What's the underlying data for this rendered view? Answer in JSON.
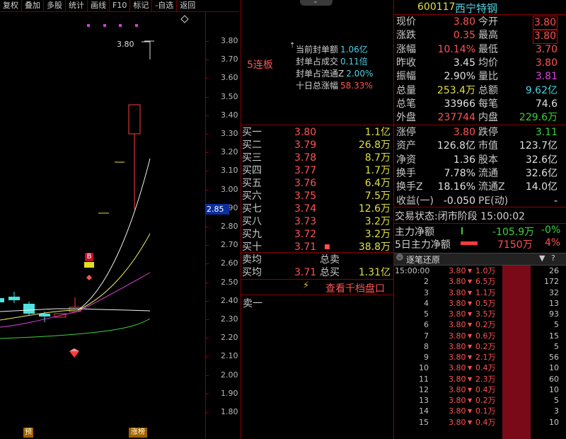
{
  "toolbar": {
    "items": [
      "复权",
      "叠加",
      "多股",
      "统计",
      "画线",
      "F10",
      "标记",
      "-自选",
      "返回"
    ]
  },
  "chart": {
    "price_ticks": [
      "3.80",
      "3.70",
      "3.60",
      "3.50",
      "3.40",
      "3.30",
      "3.20",
      "3.10",
      "3.00",
      "2.90",
      "2.80",
      "2.70",
      "2.60",
      "2.50",
      "2.40",
      "2.30",
      "2.20",
      "2.10",
      "2.00",
      "1.90",
      "1.80"
    ],
    "high_label": "3.80",
    "current_price_marker": "2.85",
    "badge_b": "B",
    "bottom_tag_left": "预",
    "bottom_tag_right": "涨榜",
    "colors": {
      "up": "#ff3b3b",
      "down": "#4fe0e0",
      "ma5": "#f0f0f0",
      "ma10": "#f0f060",
      "ma20": "#e040e0",
      "ma60": "#40d040"
    }
  },
  "middle": {
    "limit_title": "5连板",
    "stats": [
      {
        "label": "当前封单额",
        "value": "1.06亿",
        "color": "#4fd1e0"
      },
      {
        "label": "封单占成交",
        "value": "0.11倍",
        "color": "#4fd1e0"
      },
      {
        "label": "封单占流通Z",
        "value": "2.00%",
        "color": "#4fd1e0"
      },
      {
        "label": "十日总涨幅",
        "value": "58.33%",
        "color": "#ff5252"
      }
    ],
    "order_book": [
      {
        "label": "买一",
        "price": "3.80",
        "vol": "1.1亿"
      },
      {
        "label": "买二",
        "price": "3.79",
        "vol": "26.8万"
      },
      {
        "label": "买三",
        "price": "3.78",
        "vol": "8.7万"
      },
      {
        "label": "买四",
        "price": "3.77",
        "vol": "1.7万"
      },
      {
        "label": "买五",
        "price": "3.76",
        "vol": "6.4万"
      },
      {
        "label": "买六",
        "price": "3.75",
        "vol": "7.5万"
      },
      {
        "label": "买七",
        "price": "3.74",
        "vol": "12.6万"
      },
      {
        "label": "买八",
        "price": "3.73",
        "vol": "3.2万"
      },
      {
        "label": "买九",
        "price": "3.72",
        "vol": "3.2万"
      },
      {
        "label": "买十",
        "price": "3.71",
        "vol": "38.8万"
      }
    ],
    "sell_avg_label": "卖均",
    "sell_total_label": "总卖",
    "buy_avg_label": "买均",
    "buy_avg_price": "3.71",
    "buy_total_label": "总买",
    "buy_total_value": "1.31亿",
    "depth_link": "查看千档盘口",
    "sell_one": "卖一"
  },
  "quote": {
    "code": "600117",
    "name": "西宁特钢",
    "rows": [
      {
        "l1": "现价",
        "v1": "3.80",
        "c1": "#ff5252",
        "l2": "今开",
        "v2": "3.80",
        "c2": "#ff5252",
        "box2": true
      },
      {
        "l1": "涨跌",
        "v1": "0.35",
        "c1": "#ff5252",
        "l2": "最高",
        "v2": "3.80",
        "c2": "#ff5252",
        "box2": true
      },
      {
        "l1": "涨幅",
        "v1": "10.14%",
        "c1": "#ff5252",
        "l2": "最低",
        "v2": "3.70",
        "c2": "#ff5252"
      },
      {
        "l1": "昨收",
        "v1": "3.45",
        "c1": "#e0e0e0",
        "l2": "均价",
        "v2": "3.80",
        "c2": "#ff5252"
      },
      {
        "l1": "振幅",
        "v1": "2.90%",
        "c1": "#e0e0e0",
        "l2": "量比",
        "v2": "3.81",
        "c2": "#e040e0"
      },
      {
        "l1": "总量",
        "v1": "253.4万",
        "c1": "#e0e040",
        "l2": "总额",
        "v2": "9.62亿",
        "c2": "#4fd1e0"
      },
      {
        "l1": "总笔",
        "v1": "33966",
        "c1": "#e0e0e0",
        "l2": "每笔",
        "v2": "74.6",
        "c2": "#e0e0e0"
      },
      {
        "l1": "外盘",
        "v1": "237744",
        "c1": "#ff5252",
        "l2": "内盘",
        "v2": "229.6万",
        "c2": "#3bd13b"
      }
    ],
    "rows2": [
      {
        "l1": "涨停",
        "v1": "3.80",
        "c1": "#ff5252",
        "l2": "跌停",
        "v2": "3.11",
        "c2": "#3bd13b"
      },
      {
        "l1": "资产",
        "v1": "126.8亿",
        "c1": "#e0e0e0",
        "l2": "市值",
        "v2": "123.7亿",
        "c2": "#e0e0e0"
      },
      {
        "l1": "净资",
        "v1": "1.36",
        "c1": "#e0e0e0",
        "l2": "股本",
        "v2": "32.6亿",
        "c2": "#e0e0e0"
      },
      {
        "l1": "换手",
        "v1": "7.78%",
        "c1": "#e0e0e0",
        "l2": "流通",
        "v2": "32.6亿",
        "c2": "#e0e0e0"
      },
      {
        "l1": "换手Z",
        "v1": "18.16%",
        "c1": "#e0e0e0",
        "l2": "流通Z",
        "v2": "14.0亿",
        "c2": "#e0e0e0"
      },
      {
        "l1": "收益(一)",
        "v1": "-0.050",
        "c1": "#e0e0e0",
        "l2": "PE(动)",
        "v2": "-",
        "c2": "#e0e0e0"
      }
    ],
    "trade_status_label": "交易状态:",
    "trade_status_value": "闭市阶段 15:00:02",
    "main_net_label": "主力净额",
    "main_net_value": "-105.9万",
    "main_net_pct": "-0%",
    "main_net5_label": "5日主力净额",
    "main_net5_value": "7150万",
    "main_net5_pct": "4%",
    "tick_header": "逐笔还原",
    "ticks": [
      {
        "t": "15:00:00",
        "p": "3.80",
        "v": "1.0万",
        "n": "26"
      },
      {
        "t": "2",
        "p": "3.80",
        "v": "6.5万",
        "n": "172"
      },
      {
        "t": "3",
        "p": "3.80",
        "v": "1.1万",
        "n": "32"
      },
      {
        "t": "4",
        "p": "3.80",
        "v": "0.5万",
        "n": "13"
      },
      {
        "t": "5",
        "p": "3.80",
        "v": "3.5万",
        "n": "93"
      },
      {
        "t": "6",
        "p": "3.80",
        "v": "0.2万",
        "n": "5"
      },
      {
        "t": "7",
        "p": "3.80",
        "v": "0.6万",
        "n": "15"
      },
      {
        "t": "8",
        "p": "3.80",
        "v": "0.2万",
        "n": "5"
      },
      {
        "t": "9",
        "p": "3.80",
        "v": "2.1万",
        "n": "56"
      },
      {
        "t": "10",
        "p": "3.80",
        "v": "0.4万",
        "n": "10"
      },
      {
        "t": "11",
        "p": "3.80",
        "v": "2.3万",
        "n": "60"
      },
      {
        "t": "12",
        "p": "3.80",
        "v": "0.4万",
        "n": "10"
      },
      {
        "t": "13",
        "p": "3.80",
        "v": "0.2万",
        "n": "5"
      },
      {
        "t": "14",
        "p": "3.80",
        "v": "0.1万",
        "n": "3"
      },
      {
        "t": "15",
        "p": "3.80",
        "v": "0.4万",
        "n": "10"
      }
    ]
  }
}
